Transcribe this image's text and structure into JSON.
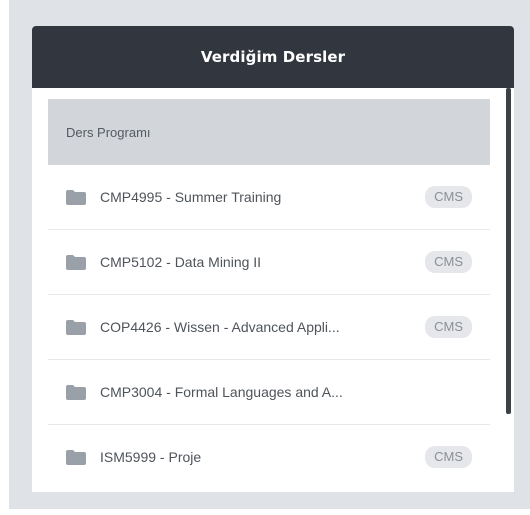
{
  "panel": {
    "title": "Verdiğim Dersler"
  },
  "section": {
    "label": "Ders Programı"
  },
  "courses": [
    {
      "label": "CMP4995 - Summer Training",
      "badge": "CMS",
      "icon": "folder-icon"
    },
    {
      "label": "CMP5102 - Data Mining II",
      "badge": "CMS",
      "icon": "folder-icon"
    },
    {
      "label": "COP4426 - Wissen - Advanced Appli...",
      "badge": "CMS",
      "icon": "folder-icon"
    },
    {
      "label": "CMP3004 - Formal Languages and A...",
      "badge": null,
      "icon": "folder-icon"
    },
    {
      "label": "ISM5999 - Proje",
      "badge": "CMS",
      "icon": "folder-icon"
    }
  ],
  "colors": {
    "header_bg": "#32363f",
    "section_bg": "#d2d6da",
    "outer_bg": "#dfe2e6",
    "folder": "#9aa0a8",
    "badge_bg": "#e5e7ea"
  }
}
